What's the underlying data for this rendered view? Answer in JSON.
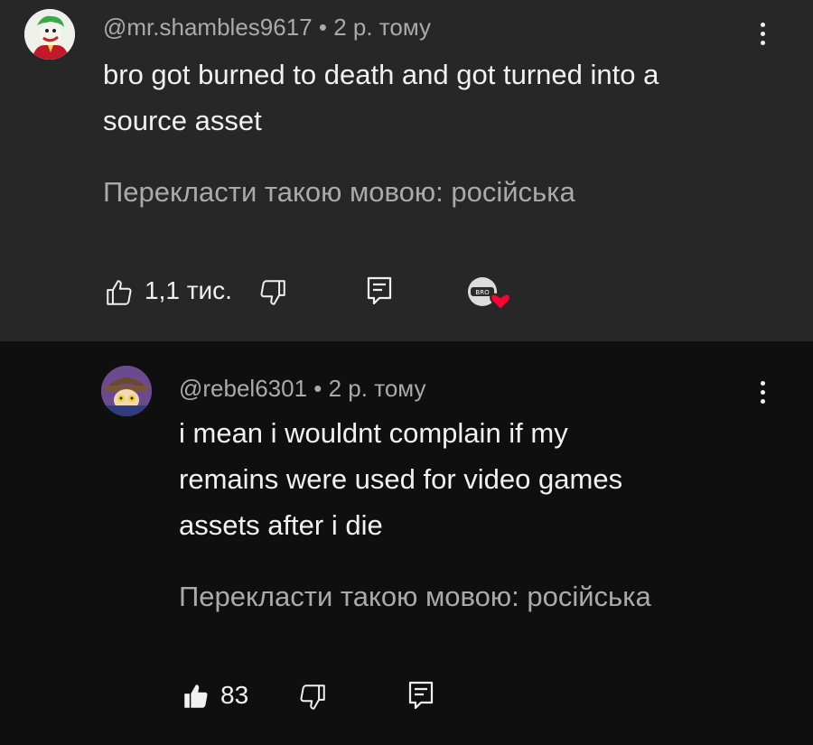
{
  "comments": [
    {
      "author": "@mr.shambles9617",
      "time": "2 р. тому",
      "text_lines": [
        "bro got burned to death and got turned into a",
        "source asset"
      ],
      "translate": "Перекласти такою мовою: російська",
      "likes": "1,1 тис.",
      "avatar_icon": "joker-avatar",
      "creator_heart_icon": "creator-heart-avatar",
      "heart_color": "#ff0033"
    },
    {
      "author": "@rebel6301",
      "time": "2 р. тому",
      "text_lines": [
        "i mean i wouldnt complain if my",
        "remains were used for video games",
        "assets after i die"
      ],
      "translate": "Перекласти такою мовою: російська",
      "likes": "83",
      "avatar_icon": "niko-avatar"
    }
  ]
}
